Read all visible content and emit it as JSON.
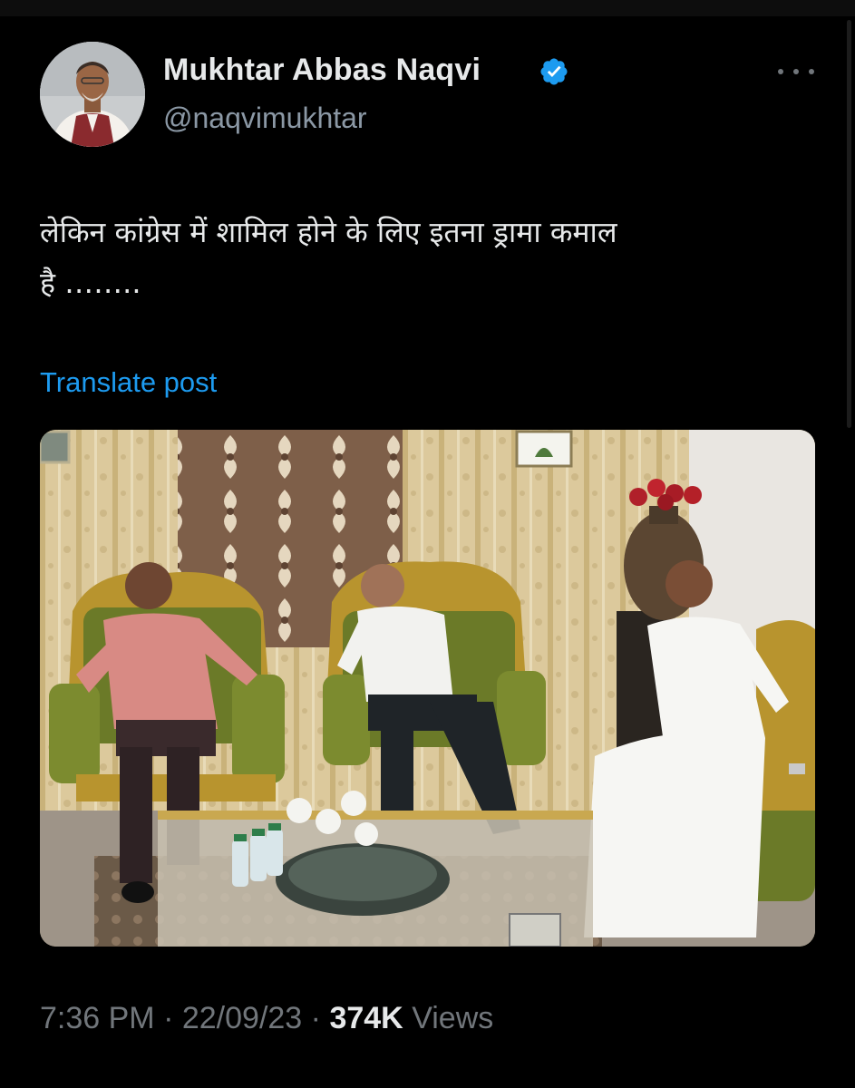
{
  "author": {
    "name": "Mukhtar Abbas Naqvi",
    "handle": "@naqvimukhtar",
    "verified_color": "#1d9bf0"
  },
  "icons": {
    "verified": "verified-badge-icon",
    "more": "more-options-icon"
  },
  "post": {
    "text_line1": "लेकिन कांग्रेस में शामिल होने के लिए  इतना ड्रामा कमाल",
    "text_line2": "है ……..",
    "translate_label": "Translate post",
    "time": "7:36 PM",
    "date": "22/09/23",
    "views_count": "374K",
    "views_label": "Views",
    "separator": "·"
  },
  "colors": {
    "background": "#000000",
    "link": "#1d9bf0",
    "muted": "#71767b"
  }
}
